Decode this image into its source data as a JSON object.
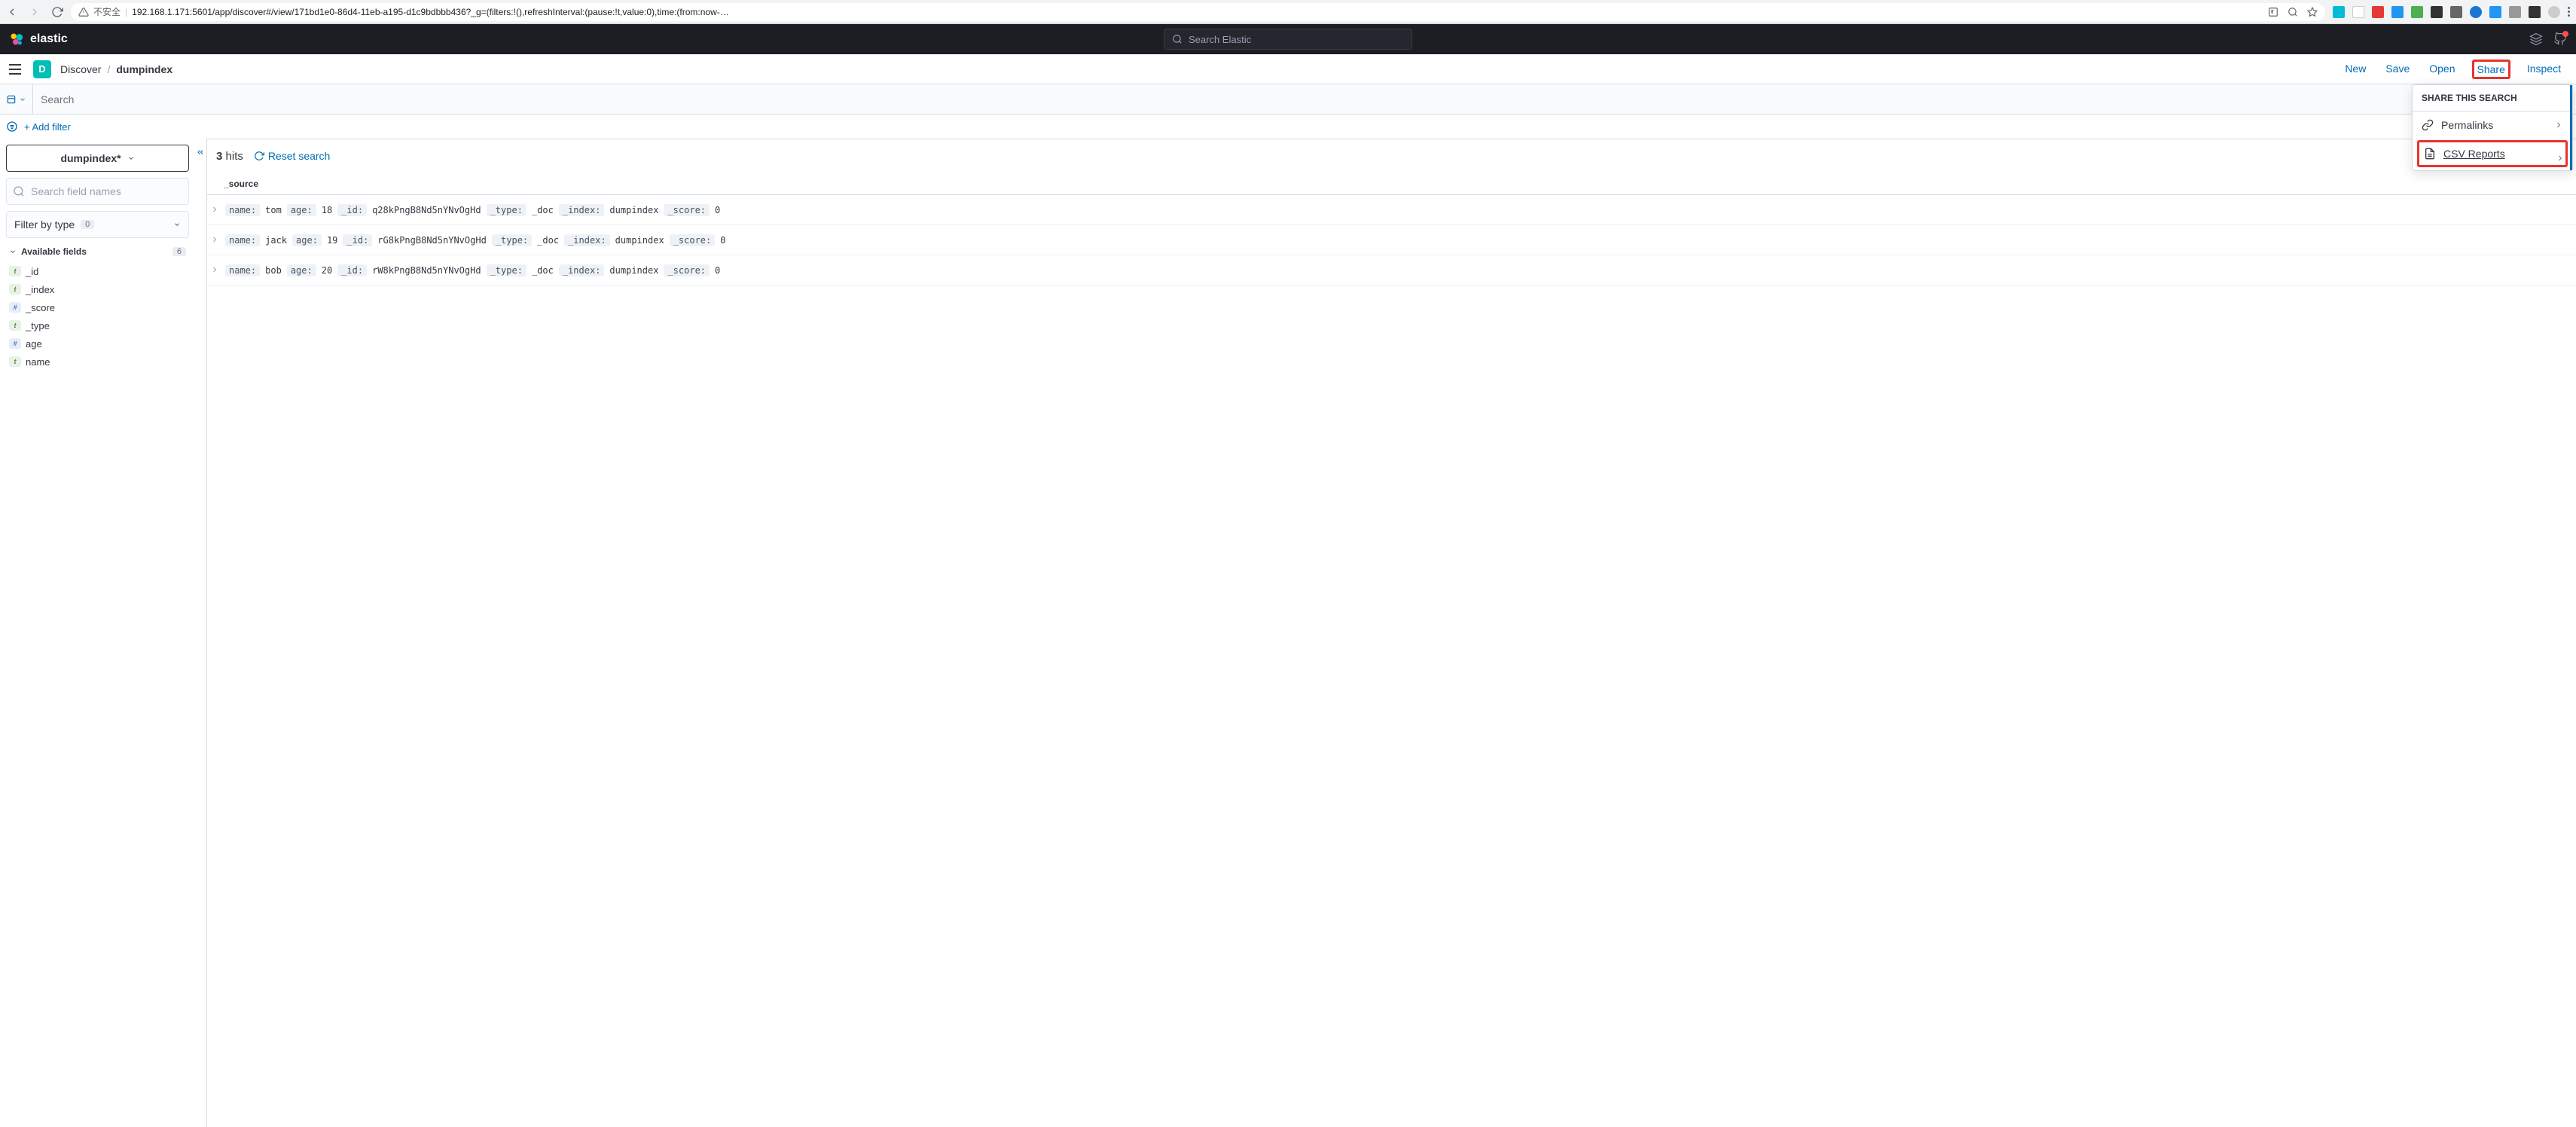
{
  "browser": {
    "security_label": "不安全",
    "url": "192.168.1.171:5601/app/discover#/view/171bd1e0-86d4-11eb-a195-d1c9bdbbb436?_g=(filters:!(),refreshInterval:(pause:!t,value:0),time:(from:now-…"
  },
  "header": {
    "brand": "elastic",
    "search_placeholder": "Search Elastic"
  },
  "subheader": {
    "space_letter": "D",
    "breadcrumb_app": "Discover",
    "breadcrumb_current": "dumpindex",
    "actions": {
      "new": "New",
      "save": "Save",
      "open": "Open",
      "share": "Share",
      "inspect": "Inspect"
    }
  },
  "querybar": {
    "placeholder": "Search"
  },
  "filterbar": {
    "add_filter": "+ Add filter"
  },
  "sidebar": {
    "index_pattern": "dumpindex*",
    "field_search_placeholder": "Search field names",
    "filter_by_type_label": "Filter by type",
    "filter_by_type_count": "0",
    "available_fields_label": "Available fields",
    "available_fields_count": "6",
    "fields": [
      {
        "type": "t",
        "name": "_id"
      },
      {
        "type": "t",
        "name": "_index"
      },
      {
        "type": "#",
        "name": "_score"
      },
      {
        "type": "t",
        "name": "_type"
      },
      {
        "type": "#",
        "name": "age"
      },
      {
        "type": "t",
        "name": "name"
      }
    ]
  },
  "content": {
    "hits_number": "3",
    "hits_label": "hits",
    "reset_search": "Reset search",
    "source_col": "_source",
    "docs": [
      {
        "name": "tom",
        "age": "18",
        "_id": "q28kPngB8Nd5nYNvOgHd",
        "_type": "_doc",
        "_index": "dumpindex",
        "_score": "0"
      },
      {
        "name": "jack",
        "age": "19",
        "_id": "rG8kPngB8Nd5nYNvOgHd",
        "_type": "_doc",
        "_index": "dumpindex",
        "_score": "0"
      },
      {
        "name": "bob",
        "age": "20",
        "_id": "rW8kPngB8Nd5nYNvOgHd",
        "_type": "_doc",
        "_index": "dumpindex",
        "_score": "0"
      }
    ],
    "labels": {
      "name": "name:",
      "age": "age:",
      "id": "_id:",
      "type": "_type:",
      "index": "_index:",
      "score": "_score:"
    }
  },
  "share_popover": {
    "title": "SHARE THIS SEARCH",
    "permalinks": "Permalinks",
    "csv_reports": "CSV Reports"
  }
}
